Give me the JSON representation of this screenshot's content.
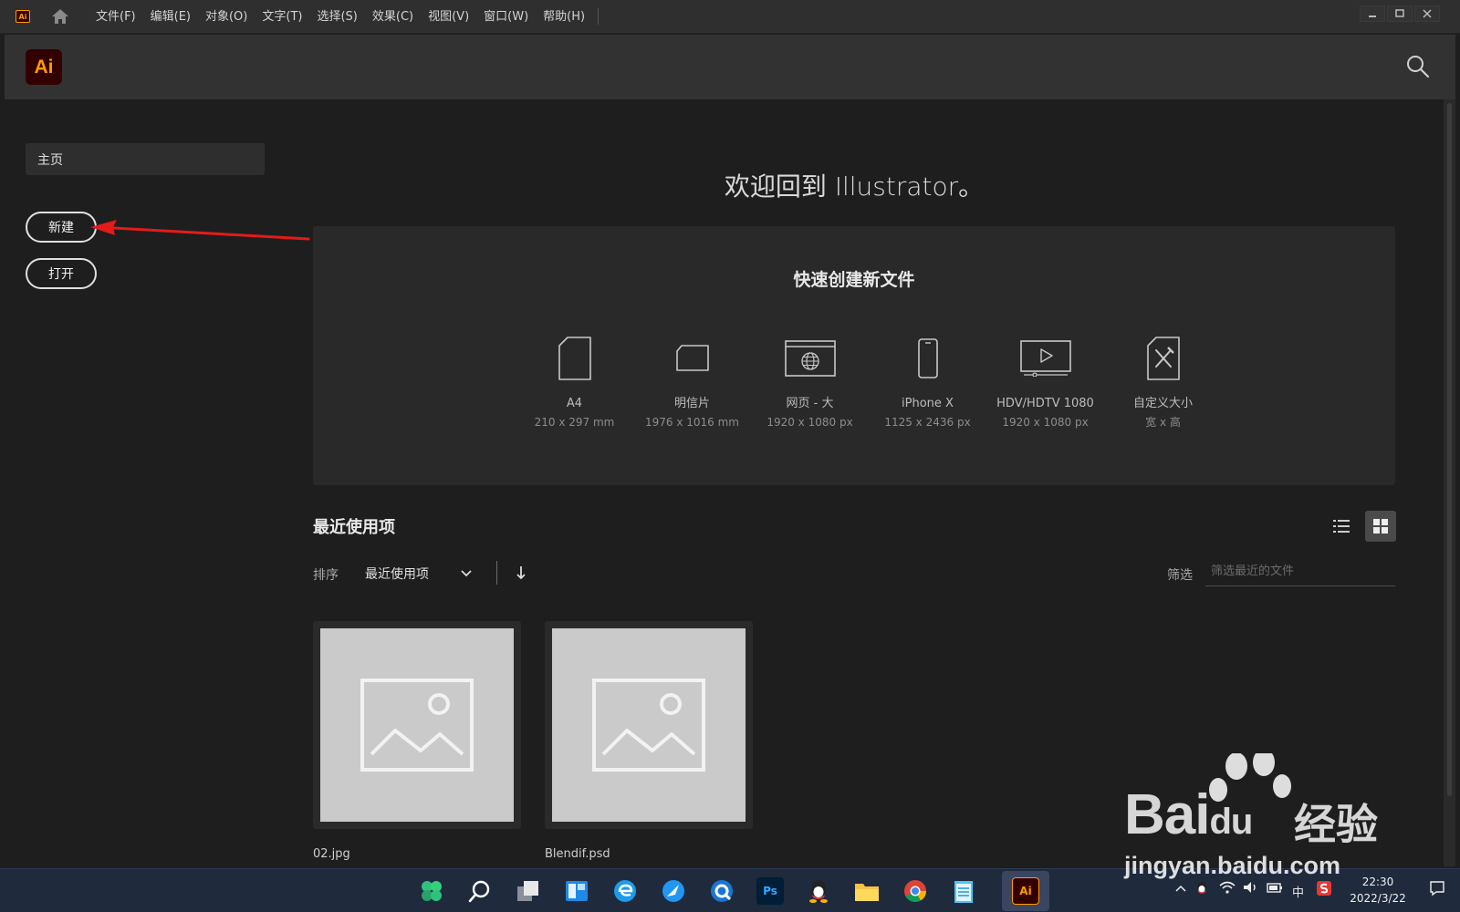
{
  "menubar": {
    "app_badge": "Ai",
    "items": [
      "文件(F)",
      "编辑(E)",
      "对象(O)",
      "文字(T)",
      "选择(S)",
      "效果(C)",
      "视图(V)",
      "窗口(W)",
      "帮助(H)"
    ]
  },
  "header": {
    "logo": "Ai"
  },
  "sidebar": {
    "home": "主页",
    "new_button": "新建",
    "open_button": "打开"
  },
  "welcome": "欢迎回到 Illustrator。",
  "quick_create": {
    "title": "快速创建新文件",
    "presets": [
      {
        "name": "A4",
        "size": "210 x 297 mm",
        "icon": "document-icon"
      },
      {
        "name": "明信片",
        "size": "1976 x 1016 mm",
        "icon": "postcard-icon"
      },
      {
        "name": "网页 - 大",
        "size": "1920 x 1080 px",
        "icon": "web-icon"
      },
      {
        "name": "iPhone X",
        "size": "1125 x 2436 px",
        "icon": "phone-icon"
      },
      {
        "name": "HDV/HDTV 1080",
        "size": "1920 x 1080 px",
        "icon": "video-icon"
      },
      {
        "name": "自定义大小",
        "size": "宽 x 高",
        "icon": "custom-size-icon"
      }
    ]
  },
  "recent": {
    "title": "最近使用项",
    "sort_label": "排序",
    "sort_value": "最近使用项",
    "filter_label": "筛选",
    "filter_placeholder": "筛选最近的文件",
    "files": [
      "02.jpg",
      "Blendif.psd"
    ]
  },
  "taskbar": {
    "photoshop_label": "Ps",
    "illustrator_label": "Ai",
    "ime": "中",
    "time": "22:30",
    "date": "2022/3/22"
  },
  "watermark": {
    "brand": "Bai",
    "brand_suffix": "du",
    "cn": "经验",
    "url": "jingyan.baidu.com"
  },
  "colors": {
    "accent_orange": "#ff9a00",
    "logo_bg": "#330000",
    "annotation_red": "#e31b1b"
  }
}
